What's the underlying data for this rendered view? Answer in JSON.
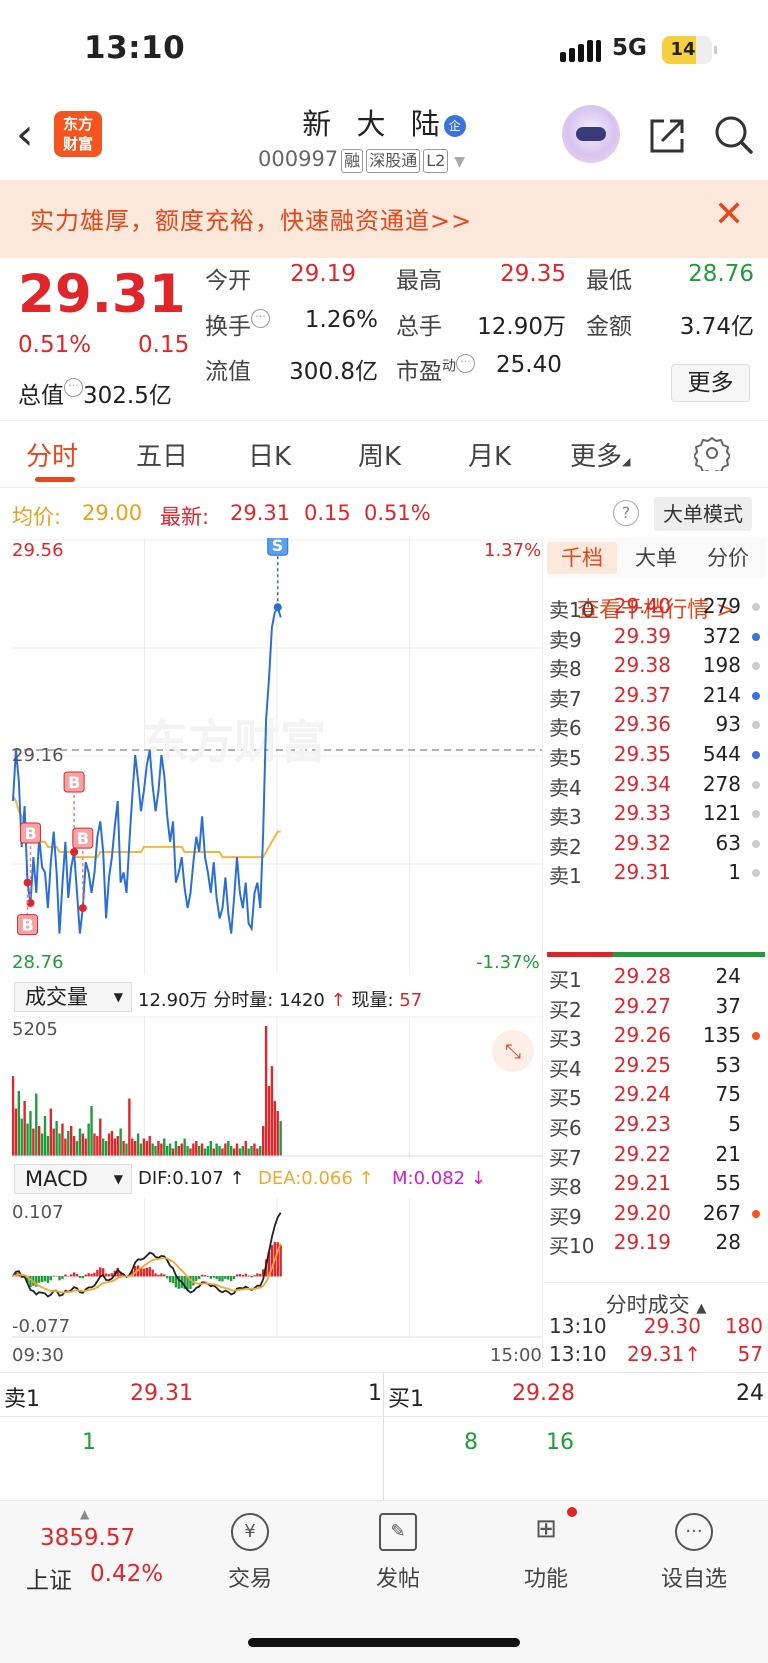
{
  "status": {
    "time": "13:10",
    "network": "5G",
    "battery": "14"
  },
  "header": {
    "stock_name": "新 大 陆",
    "badge": "企",
    "code": "000997",
    "tags": [
      "融",
      "深股通",
      "L2"
    ],
    "logo_line1": "东方",
    "logo_line2": "财富"
  },
  "banner": {
    "text": "实力雄厚，额度充裕，快速融资通道>>"
  },
  "quote": {
    "price": "29.31",
    "change_pct": "0.51%",
    "change": "0.15",
    "total_value_label": "总值",
    "total_value": "302.5亿",
    "open_label": "今开",
    "open": "29.19",
    "high_label": "最高",
    "high": "29.35",
    "low_label": "最低",
    "low": "28.76",
    "turnover_label": "换手",
    "turnover": "1.26%",
    "volume_label": "总手",
    "volume": "12.90万",
    "amount_label": "金额",
    "amount": "3.74亿",
    "float_label": "流值",
    "float_value": "300.8亿",
    "pe_label": "市盈",
    "pe_sup": "动",
    "pe": "25.40",
    "more": "更多"
  },
  "tabs": [
    "分时",
    "五日",
    "日K",
    "周K",
    "月K",
    "更多"
  ],
  "chart_info": {
    "avg_label": "均价:",
    "avg": "29.00",
    "latest_label": "最新:",
    "latest": "29.31",
    "latest_change": "0.15",
    "latest_pct": "0.51%",
    "mode": "大单模式"
  },
  "chart_data": {
    "type": "line",
    "y_high": "29.56",
    "y_mid": "29.16",
    "y_low": "28.76",
    "pct_high": "1.37%",
    "pct_low": "-1.37%",
    "ylim": [
      28.76,
      29.56
    ],
    "prev_close": 29.16,
    "x_start": "09:30",
    "x_end": "15:00",
    "series": [
      {
        "values": [
          29.06,
          29.16,
          29.1,
          28.97,
          29.05,
          28.9,
          28.86,
          28.95,
          28.88,
          28.99,
          28.93,
          28.92,
          28.85,
          28.94,
          29.0,
          28.92,
          28.8,
          28.9,
          28.98,
          28.87,
          28.93,
          28.96,
          28.88,
          28.8,
          28.85,
          28.94,
          28.92,
          28.88,
          28.92,
          28.99,
          29.02,
          28.96,
          28.83,
          28.91,
          28.95,
          29.01,
          29.06,
          28.9,
          28.92,
          28.88,
          28.98,
          29.07,
          29.15,
          29.1,
          29.04,
          29.08,
          29.13,
          29.16,
          29.09,
          29.04,
          29.08,
          29.15,
          29.11,
          29.03,
          28.98,
          29.02,
          28.9,
          28.92,
          28.95,
          28.89,
          28.85,
          28.88,
          28.94,
          28.99,
          28.96,
          29.03,
          28.95,
          28.92,
          28.88,
          28.94,
          28.87,
          28.83,
          28.85,
          28.91,
          28.84,
          28.8,
          28.87,
          28.95,
          28.88,
          28.85,
          28.9,
          28.82,
          28.81,
          28.88,
          28.9,
          28.85,
          29.0,
          29.22,
          29.3,
          29.4,
          29.43,
          29.44,
          29.42
        ]
      },
      {
        "values": [
          29.07,
          29.06,
          29.04,
          29.03,
          29.02,
          29.01,
          29.0,
          28.99,
          28.99,
          28.98,
          28.98,
          28.98,
          28.97,
          28.97,
          28.97,
          28.97,
          28.96,
          28.96,
          28.96,
          28.96,
          28.96,
          28.95,
          28.95,
          28.95,
          28.95,
          28.95,
          28.95,
          28.95,
          28.95,
          28.95,
          28.96,
          28.96,
          28.96,
          28.96,
          28.96,
          28.96,
          28.96,
          28.96,
          28.96,
          28.96,
          28.96,
          28.96,
          28.96,
          28.96,
          28.96,
          28.97,
          28.97,
          28.97,
          28.97,
          28.97,
          28.97,
          28.97,
          28.97,
          28.97,
          28.97,
          28.97,
          28.97,
          28.97,
          28.97,
          28.96,
          28.96,
          28.96,
          28.96,
          28.96,
          28.96,
          28.96,
          28.96,
          28.96,
          28.96,
          28.96,
          28.96,
          28.96,
          28.95,
          28.95,
          28.95,
          28.95,
          28.95,
          28.95,
          28.95,
          28.95,
          28.95,
          28.95,
          28.95,
          28.95,
          28.95,
          28.95,
          28.95,
          28.96,
          28.97,
          28.98,
          28.99,
          29.0,
          29.0
        ]
      }
    ],
    "volume_max": "5205",
    "volume": [
      3200,
      1900,
      2600,
      1500,
      2200,
      1300,
      1800,
      1100,
      2500,
      1200,
      900,
      1600,
      800,
      1900,
      1100,
      1400,
      900,
      1300,
      700,
      1000,
      1200,
      800,
      600,
      1100,
      900,
      700,
      1300,
      2000,
      900,
      800,
      1500,
      700,
      600,
      900,
      1000,
      700,
      800,
      1100,
      600,
      500,
      2300,
      700,
      600,
      900,
      500,
      700,
      600,
      800,
      500,
      400,
      600,
      500,
      700,
      400,
      500,
      300,
      600,
      400,
      500,
      700,
      400,
      300,
      500,
      600,
      400,
      500,
      300,
      400,
      600,
      300,
      500,
      400,
      300,
      500,
      600,
      400,
      300,
      500,
      300,
      400,
      600,
      300,
      400,
      500,
      300,
      400,
      1200,
      5205,
      2800,
      3600,
      2200,
      1800,
      1400
    ],
    "macd_high": "0.107",
    "macd_low": "-0.077"
  },
  "volume_bar": {
    "select": "成交量",
    "total": "12.90万",
    "fen_label": "分时量:",
    "fen_value": "1420",
    "xian_label": "现量:",
    "xian_value": "57"
  },
  "macd_bar": {
    "select": "MACD",
    "dif": "DIF:0.107",
    "dea": "DEA:0.066",
    "m": "M:0.082"
  },
  "orderbook": {
    "tabs": [
      "千档",
      "大单",
      "分价"
    ],
    "link": "查看千档行情 >",
    "asks": [
      [
        "卖10",
        "29.40",
        "279"
      ],
      [
        "卖9",
        "29.39",
        "372"
      ],
      [
        "卖8",
        "29.38",
        "198"
      ],
      [
        "卖7",
        "29.37",
        "214"
      ],
      [
        "卖6",
        "29.36",
        "93"
      ],
      [
        "卖5",
        "29.35",
        "544"
      ],
      [
        "卖4",
        "29.34",
        "278"
      ],
      [
        "卖3",
        "29.33",
        "121"
      ],
      [
        "卖2",
        "29.32",
        "63"
      ],
      [
        "卖1",
        "29.31",
        "1"
      ]
    ],
    "bids": [
      [
        "买1",
        "29.28",
        "24"
      ],
      [
        "买2",
        "29.27",
        "37"
      ],
      [
        "买3",
        "29.26",
        "135"
      ],
      [
        "买4",
        "29.25",
        "53"
      ],
      [
        "买5",
        "29.24",
        "75"
      ],
      [
        "买6",
        "29.23",
        "5"
      ],
      [
        "买7",
        "29.22",
        "21"
      ],
      [
        "买8",
        "29.21",
        "55"
      ],
      [
        "买9",
        "29.20",
        "267"
      ],
      [
        "买10",
        "29.19",
        "28"
      ]
    ],
    "trades_title": "分时成交",
    "trades": [
      [
        "13:10",
        "29.30",
        "180"
      ],
      [
        "13:10",
        "29.31↑",
        "57"
      ]
    ]
  },
  "strip": {
    "sell_label": "卖1",
    "sell_price": "29.31",
    "sell_qty": "1",
    "buy_label": "买1",
    "buy_price": "29.28",
    "buy_qty": "24",
    "row2": [
      "1",
      "8",
      "16"
    ]
  },
  "bottom": {
    "index_value": "3859.57",
    "index_name": "上证",
    "index_pct": "0.42%",
    "items": [
      "交易",
      "发帖",
      "功能",
      "设自选"
    ]
  }
}
